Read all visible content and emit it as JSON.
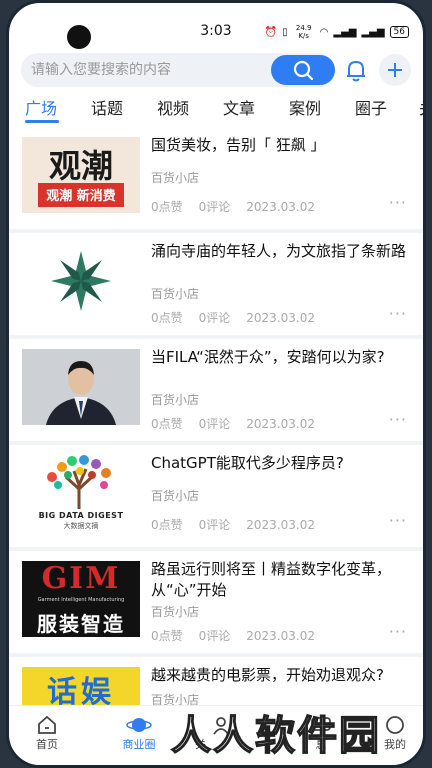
{
  "status": {
    "time": "3:03",
    "net_speed": "24.9 K/s",
    "battery": "56"
  },
  "search": {
    "placeholder": "请输入您要搜索的内容"
  },
  "tabs": [
    "广场",
    "话题",
    "视频",
    "文章",
    "案例",
    "圈子",
    "关"
  ],
  "feed": [
    {
      "title": "国货美妆，告别「 狂飙 」",
      "shop": "百货小店",
      "likes": "0点赞",
      "comments": "0评论",
      "date": "2023.03.02",
      "thumb_text": "观潮 新消费"
    },
    {
      "title": "涌向寺庙的年轻人，为文旅指了条新路",
      "shop": "百货小店",
      "likes": "0点赞",
      "comments": "0评论",
      "date": "2023.03.02"
    },
    {
      "title": "当FILA“泯然于众”，安踏何以为家?",
      "shop": "百货小店",
      "likes": "0点赞",
      "comments": "0评论",
      "date": "2023.03.02"
    },
    {
      "title": "ChatGPT能取代多少程序员?",
      "shop": "百货小店",
      "likes": "0点赞",
      "comments": "0评论",
      "date": "2023.03.02",
      "thumb_text": "BIG DATA DIGEST",
      "thumb_sub": "大数据文摘"
    },
    {
      "title": "路虽远行则将至丨精益数字化变革，从“心”开始",
      "shop": "百货小店",
      "likes": "0点赞",
      "comments": "0评论",
      "date": "2023.03.02",
      "thumb_text": "GIM",
      "thumb_sub": "Garment Intelligent Manufacturing",
      "thumb_sub2": "服装智造"
    },
    {
      "title": "越来越贵的电影票，开始劝退观众?",
      "shop": "百货小店",
      "thumb_text": "话娱"
    }
  ],
  "more_glyph": "···",
  "bottom_nav": [
    {
      "label": "首页",
      "icon": "home-icon"
    },
    {
      "label": "商业圈",
      "icon": "planet-icon",
      "active": true
    },
    {
      "label": "关",
      "icon": "user-icon"
    },
    {
      "label": "息",
      "icon": "message-icon"
    },
    {
      "label": "我的",
      "icon": "profile-icon"
    }
  ],
  "watermark": "人人软件园",
  "colors": {
    "accent": "#2f7cf3",
    "feed_bg": "#f2f3f5"
  }
}
